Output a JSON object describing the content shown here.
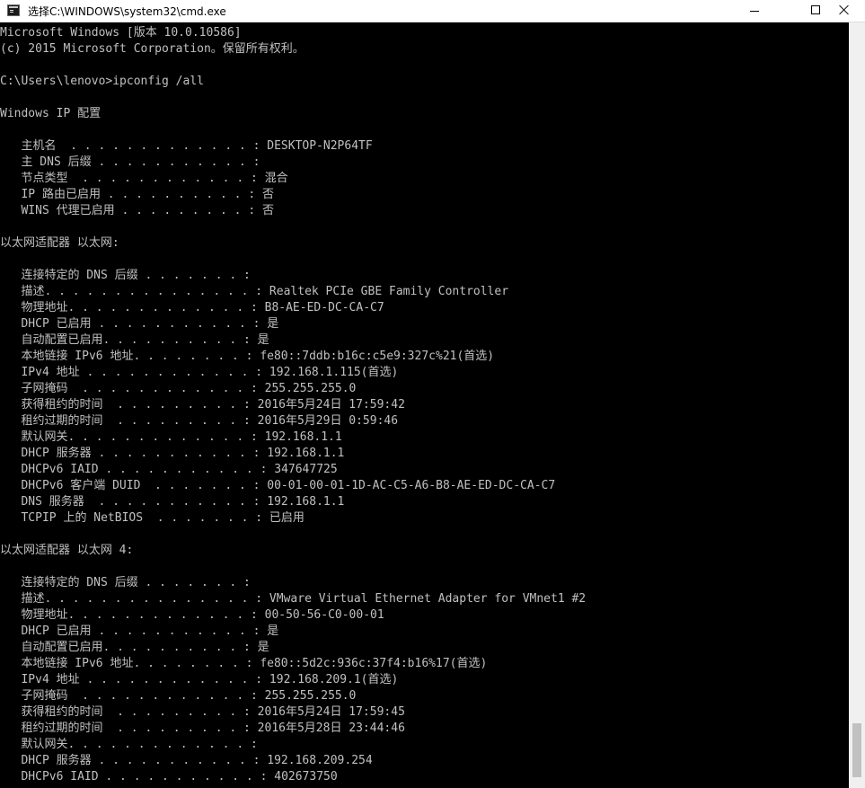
{
  "window": {
    "title": "选择C:\\WINDOWS\\system32\\cmd.exe"
  },
  "console": {
    "lines": [
      "Microsoft Windows [版本 10.0.10586]",
      "(c) 2015 Microsoft Corporation。保留所有权利。",
      "",
      "C:\\Users\\lenovo>ipconfig /all",
      "",
      "Windows IP 配置",
      "",
      "   主机名  . . . . . . . . . . . . . : DESKTOP-N2P64TF",
      "   主 DNS 后缀 . . . . . . . . . . . :",
      "   节点类型  . . . . . . . . . . . . : 混合",
      "   IP 路由已启用 . . . . . . . . . . : 否",
      "   WINS 代理已启用 . . . . . . . . . : 否",
      "",
      "以太网适配器 以太网:",
      "",
      "   连接特定的 DNS 后缀 . . . . . . . :",
      "   描述. . . . . . . . . . . . . . . : Realtek PCIe GBE Family Controller",
      "   物理地址. . . . . . . . . . . . . : B8-AE-ED-DC-CA-C7",
      "   DHCP 已启用 . . . . . . . . . . . : 是",
      "   自动配置已启用. . . . . . . . . . : 是",
      "   本地链接 IPv6 地址. . . . . . . . : fe80::7ddb:b16c:c5e9:327c%21(首选)",
      "   IPv4 地址 . . . . . . . . . . . . : 192.168.1.115(首选)",
      "   子网掩码  . . . . . . . . . . . . : 255.255.255.0",
      "   获得租约的时间  . . . . . . . . . : 2016年5月24日 17:59:42",
      "   租约过期的时间  . . . . . . . . . : 2016年5月29日 0:59:46",
      "   默认网关. . . . . . . . . . . . . : 192.168.1.1",
      "   DHCP 服务器 . . . . . . . . . . . : 192.168.1.1",
      "   DHCPv6 IAID . . . . . . . . . . . : 347647725",
      "   DHCPv6 客户端 DUID  . . . . . . . : 00-01-00-01-1D-AC-C5-A6-B8-AE-ED-DC-CA-C7",
      "   DNS 服务器  . . . . . . . . . . . : 192.168.1.1",
      "   TCPIP 上的 NetBIOS  . . . . . . . : 已启用",
      "",
      "以太网适配器 以太网 4:",
      "",
      "   连接特定的 DNS 后缀 . . . . . . . :",
      "   描述. . . . . . . . . . . . . . . : VMware Virtual Ethernet Adapter for VMnet1 #2",
      "   物理地址. . . . . . . . . . . . . : 00-50-56-C0-00-01",
      "   DHCP 已启用 . . . . . . . . . . . : 是",
      "   自动配置已启用. . . . . . . . . . : 是",
      "   本地链接 IPv6 地址. . . . . . . . : fe80::5d2c:936c:37f4:b16%17(首选)",
      "   IPv4 地址 . . . . . . . . . . . . : 192.168.209.1(首选)",
      "   子网掩码  . . . . . . . . . . . . : 255.255.255.0",
      "   获得租约的时间  . . . . . . . . . : 2016年5月24日 17:59:45",
      "   租约过期的时间  . . . . . . . . . : 2016年5月28日 23:44:46",
      "   默认网关. . . . . . . . . . . . . :",
      "   DHCP 服务器 . . . . . . . . . . . : 192.168.209.254",
      "   DHCPv6 IAID . . . . . . . . . . . : 402673750"
    ]
  },
  "colors": {
    "console_background": "#000000",
    "console_text": "#c0c0c0",
    "titlebar_background": "#ffffff"
  }
}
